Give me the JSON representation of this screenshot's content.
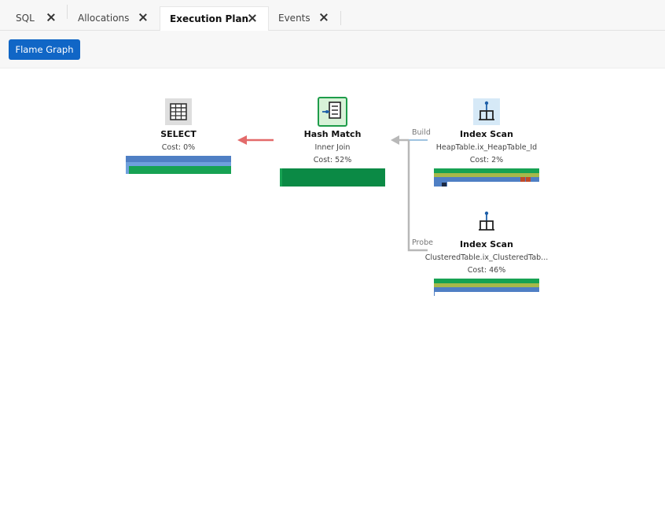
{
  "tabs": [
    {
      "label": "SQL",
      "active": false
    },
    {
      "label": "Allocations",
      "active": false
    },
    {
      "label": "Execution Plan",
      "active": true
    },
    {
      "label": "Events",
      "active": false
    }
  ],
  "toolbar": {
    "flame_graph_label": "Flame Graph"
  },
  "colors": {
    "accent": "#1066c6",
    "bar_blue": "#4f7fc4",
    "bar_light_blue": "#6fa0dc",
    "bar_green": "#17a253",
    "bar_dark_green": "#0b8a45",
    "bar_olive": "#a7b84a",
    "bar_red": "#c04a2a",
    "arrow_red": "#e36a6a",
    "arrow_grey": "#b8b8b8"
  },
  "plan": {
    "select": {
      "title": "SELECT",
      "cost": "Cost: 0%",
      "icon": "table-grid-icon"
    },
    "hash_match": {
      "title": "Hash Match",
      "subtitle": "Inner Join",
      "cost": "Cost: 52%",
      "icon": "hash-match-icon"
    },
    "index_scan_build": {
      "title": "Index Scan",
      "subtitle": "HeapTable.ix_HeapTable_Id",
      "cost": "Cost: 2%",
      "icon": "index-scan-icon"
    },
    "index_scan_probe": {
      "title": "Index Scan",
      "subtitle": "ClusteredTable.ix_ClusteredTab...",
      "cost": "Cost: 46%",
      "icon": "index-scan-icon"
    },
    "connectors": {
      "build_label": "Build",
      "probe_label": "Probe"
    }
  }
}
